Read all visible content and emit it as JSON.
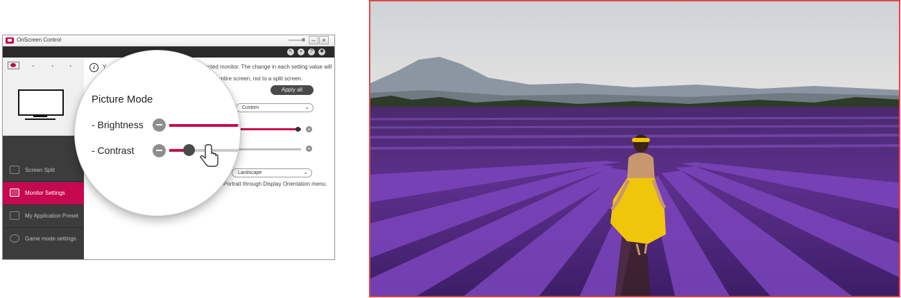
{
  "window": {
    "title": "OnScreen Control",
    "minimize_glyph": "–",
    "close_glyph": "×",
    "restore_glyph": "□",
    "toolbar_icons": [
      "cursor-icon",
      "display-icon",
      "help-icon",
      "settings-icon"
    ],
    "toolbar_help_glyph": "?"
  },
  "sidebar": {
    "items": [
      {
        "label": "Screen Split",
        "icon": "screen-split-icon",
        "active": false
      },
      {
        "label": "Monitor Settings",
        "icon": "monitor-settings-icon",
        "active": true
      },
      {
        "label": "My Application Preset",
        "icon": "app-preset-icon",
        "active": false
      },
      {
        "label": "Game mode settings",
        "icon": "gamepad-icon",
        "active": false
      }
    ]
  },
  "content": {
    "info_text_start": "Y",
    "info_text_line1_end": "elected monitor. The change in each setting value will",
    "info_text_line2_end": "entire screen, not to a split screen.",
    "apply_all_label": "Apply all",
    "picture_mode_value": "Custom",
    "orientation_value": "Landscape",
    "orientation_note": "Portrait through Display Orientation menu.",
    "brightness_level": 0.9,
    "contrast_level": 0.25
  },
  "magnifier": {
    "title": "Picture Mode",
    "brightness_label": "- Brightness",
    "contrast_label": "- Contrast"
  },
  "colors": {
    "accent": "#c6084f",
    "sidebar_bg": "#3c3c3c",
    "toolbar_bg": "#2a2a2a",
    "photo_border": "#e04646"
  }
}
